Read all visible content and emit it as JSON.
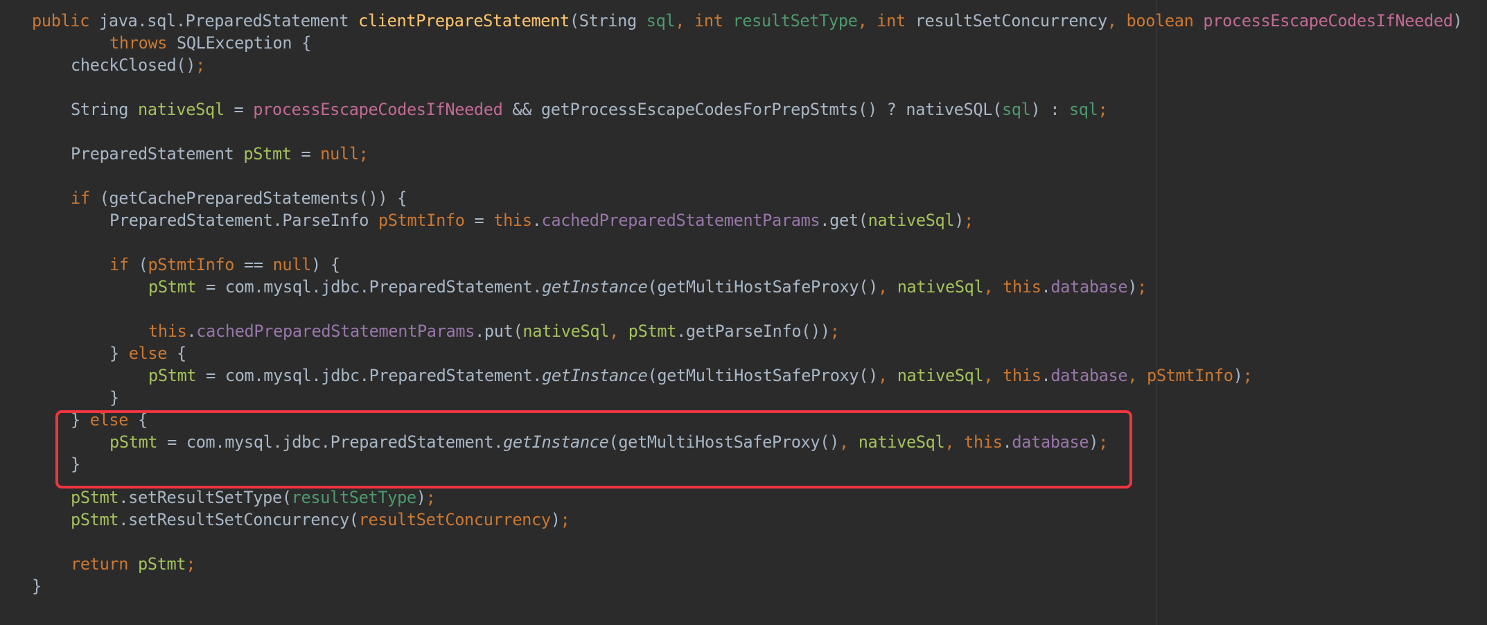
{
  "editor": {
    "highlight_color": "#ee3540",
    "background_color": "#2b2b2b",
    "lines": [
      {
        "segments": [
          {
            "t": "public ",
            "c": "kw"
          },
          {
            "t": "java.sql.PreparedStatement ",
            "c": "type"
          },
          {
            "t": "clientPrepareStatement",
            "c": "fn"
          },
          {
            "t": "(String ",
            "c": "type"
          },
          {
            "t": "sql",
            "c": "param-g"
          },
          {
            "t": ", ",
            "c": "punc"
          },
          {
            "t": "int ",
            "c": "kw"
          },
          {
            "t": "resultSetType",
            "c": "param-g"
          },
          {
            "t": ", ",
            "c": "punc"
          },
          {
            "t": "int ",
            "c": "kw"
          },
          {
            "t": "resultSetConcurrency",
            "c": "id"
          },
          {
            "t": ", ",
            "c": "punc"
          },
          {
            "t": "boolean ",
            "c": "kw"
          },
          {
            "t": "processEscapeCodesIfNeeded",
            "c": "param-p"
          },
          {
            "t": ")",
            "c": "id"
          }
        ]
      },
      {
        "segments": [
          {
            "t": "throws ",
            "c": "kw"
          },
          {
            "t": "SQLException {",
            "c": "id"
          }
        ]
      },
      {
        "segments": [
          {
            "t": "checkClosed()",
            "c": "id"
          },
          {
            "t": ";",
            "c": "punc"
          }
        ]
      },
      {
        "segments": [
          {
            "t": "String ",
            "c": "type"
          },
          {
            "t": "nativeSql",
            "c": "local"
          },
          {
            "t": " = ",
            "c": "id"
          },
          {
            "t": "processEscapeCodesIfNeeded",
            "c": "param-p"
          },
          {
            "t": " && getProcessEscapeCodesForPrepStmts() ? nativeSQL(",
            "c": "id"
          },
          {
            "t": "sql",
            "c": "param-g"
          },
          {
            "t": ") : ",
            "c": "id"
          },
          {
            "t": "sql",
            "c": "param-g"
          },
          {
            "t": ";",
            "c": "punc"
          }
        ]
      },
      {
        "segments": [
          {
            "t": "PreparedStatement ",
            "c": "type"
          },
          {
            "t": "pStmt",
            "c": "local"
          },
          {
            "t": " = ",
            "c": "id"
          },
          {
            "t": "null",
            "c": "kw"
          },
          {
            "t": ";",
            "c": "punc"
          }
        ]
      },
      {
        "segments": [
          {
            "t": "if ",
            "c": "kw"
          },
          {
            "t": "(getCachePreparedStatements()) {",
            "c": "id"
          }
        ]
      },
      {
        "segments": [
          {
            "t": "PreparedStatement.ParseInfo ",
            "c": "type"
          },
          {
            "t": "pStmtInfo",
            "c": "local2"
          },
          {
            "t": " = ",
            "c": "id"
          },
          {
            "t": "this",
            "c": "kw"
          },
          {
            "t": ".",
            "c": "id"
          },
          {
            "t": "cachedPreparedStatementParams",
            "c": "field"
          },
          {
            "t": ".get(",
            "c": "id"
          },
          {
            "t": "nativeSql",
            "c": "local"
          },
          {
            "t": ")",
            "c": "id"
          },
          {
            "t": ";",
            "c": "punc"
          }
        ]
      },
      {
        "segments": [
          {
            "t": "if ",
            "c": "kw"
          },
          {
            "t": "(",
            "c": "id"
          },
          {
            "t": "pStmtInfo",
            "c": "local2"
          },
          {
            "t": " == ",
            "c": "id"
          },
          {
            "t": "null",
            "c": "kw"
          },
          {
            "t": ") {",
            "c": "id"
          }
        ]
      },
      {
        "segments": [
          {
            "t": "pStmt",
            "c": "local"
          },
          {
            "t": " = com.mysql.jdbc.PreparedStatement.",
            "c": "id"
          },
          {
            "t": "getInstance",
            "c": "it"
          },
          {
            "t": "(getMultiHostSafeProxy()",
            "c": "id"
          },
          {
            "t": ", ",
            "c": "punc"
          },
          {
            "t": "nativeSql",
            "c": "local"
          },
          {
            "t": ", ",
            "c": "punc"
          },
          {
            "t": "this",
            "c": "kw"
          },
          {
            "t": ".",
            "c": "id"
          },
          {
            "t": "database",
            "c": "field"
          },
          {
            "t": ")",
            "c": "id"
          },
          {
            "t": ";",
            "c": "punc"
          }
        ]
      },
      {
        "segments": [
          {
            "t": "this",
            "c": "kw"
          },
          {
            "t": ".",
            "c": "id"
          },
          {
            "t": "cachedPreparedStatementParams",
            "c": "field"
          },
          {
            "t": ".put(",
            "c": "id"
          },
          {
            "t": "nativeSql",
            "c": "local"
          },
          {
            "t": ", ",
            "c": "punc"
          },
          {
            "t": "pStmt",
            "c": "local"
          },
          {
            "t": ".getParseInfo())",
            "c": "id"
          },
          {
            "t": ";",
            "c": "punc"
          }
        ]
      },
      {
        "segments": [
          {
            "t": "} ",
            "c": "id"
          },
          {
            "t": "else ",
            "c": "kw"
          },
          {
            "t": "{",
            "c": "id"
          }
        ]
      },
      {
        "segments": [
          {
            "t": "pStmt",
            "c": "local"
          },
          {
            "t": " = com.mysql.jdbc.PreparedStatement.",
            "c": "id"
          },
          {
            "t": "getInstance",
            "c": "it"
          },
          {
            "t": "(getMultiHostSafeProxy()",
            "c": "id"
          },
          {
            "t": ", ",
            "c": "punc"
          },
          {
            "t": "nativeSql",
            "c": "local"
          },
          {
            "t": ", ",
            "c": "punc"
          },
          {
            "t": "this",
            "c": "kw"
          },
          {
            "t": ".",
            "c": "id"
          },
          {
            "t": "database",
            "c": "field"
          },
          {
            "t": ", ",
            "c": "punc"
          },
          {
            "t": "pStmtInfo",
            "c": "local2"
          },
          {
            "t": ")",
            "c": "id"
          },
          {
            "t": ";",
            "c": "punc"
          }
        ]
      },
      {
        "segments": [
          {
            "t": "}",
            "c": "id"
          }
        ]
      },
      {
        "segments": [
          {
            "t": "} ",
            "c": "id"
          },
          {
            "t": "else ",
            "c": "kw"
          },
          {
            "t": "{",
            "c": "id"
          }
        ]
      },
      {
        "segments": [
          {
            "t": "pStmt",
            "c": "local"
          },
          {
            "t": " = com.mysql.jdbc.PreparedStatement.",
            "c": "id"
          },
          {
            "t": "getInstance",
            "c": "it"
          },
          {
            "t": "(getMultiHostSafeProxy()",
            "c": "id"
          },
          {
            "t": ", ",
            "c": "punc"
          },
          {
            "t": "nativeSql",
            "c": "local"
          },
          {
            "t": ", ",
            "c": "punc"
          },
          {
            "t": "this",
            "c": "kw"
          },
          {
            "t": ".",
            "c": "id"
          },
          {
            "t": "database",
            "c": "field"
          },
          {
            "t": ")",
            "c": "id"
          },
          {
            "t": ";",
            "c": "punc"
          }
        ]
      },
      {
        "segments": [
          {
            "t": "}",
            "c": "id"
          }
        ]
      },
      {
        "segments": [
          {
            "t": "pStmt",
            "c": "local"
          },
          {
            "t": ".setResultSetType(",
            "c": "id"
          },
          {
            "t": "resultSetType",
            "c": "param-g"
          },
          {
            "t": ")",
            "c": "id"
          },
          {
            "t": ";",
            "c": "punc"
          }
        ]
      },
      {
        "segments": [
          {
            "t": "pStmt",
            "c": "local"
          },
          {
            "t": ".setResultSetConcurrency(",
            "c": "id"
          },
          {
            "t": "resultSetConcurrency",
            "c": "local2"
          },
          {
            "t": ")",
            "c": "id"
          },
          {
            "t": ";",
            "c": "punc"
          }
        ]
      },
      {
        "segments": [
          {
            "t": "return ",
            "c": "kw"
          },
          {
            "t": "pStmt",
            "c": "local"
          },
          {
            "t": ";",
            "c": "punc"
          }
        ]
      },
      {
        "segments": [
          {
            "t": "}",
            "c": "id"
          }
        ]
      }
    ]
  }
}
